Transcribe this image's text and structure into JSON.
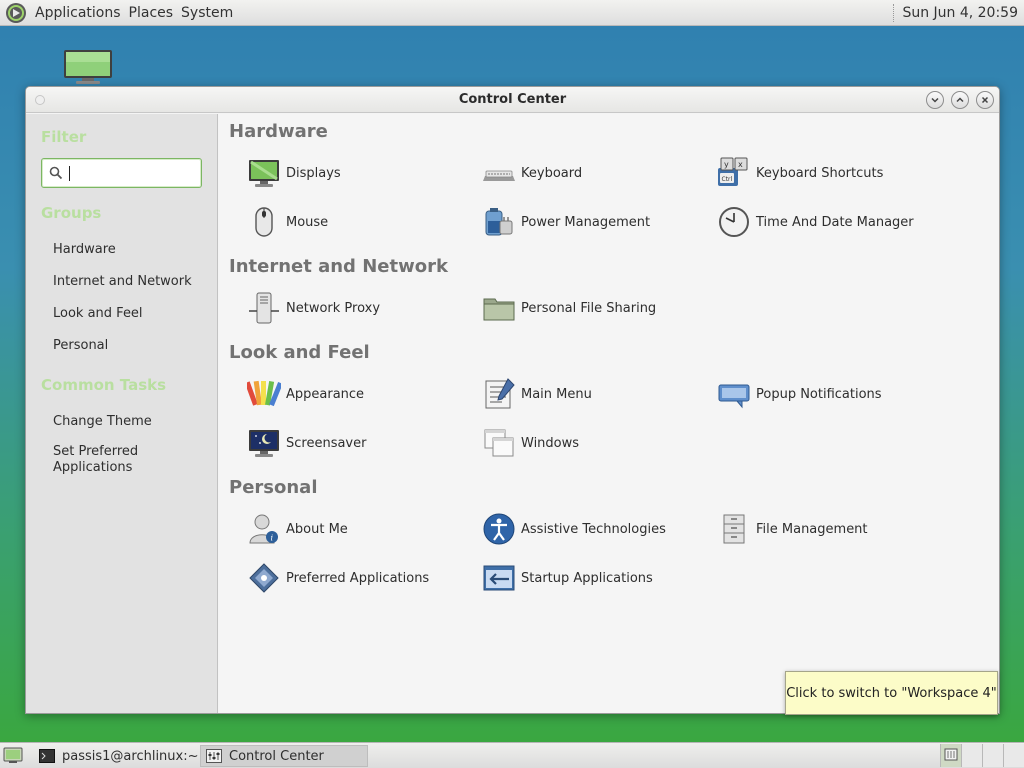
{
  "top_panel": {
    "menus": [
      "Applications",
      "Places",
      "System"
    ],
    "clock": "Sun Jun  4, 20:59"
  },
  "window": {
    "title": "Control Center"
  },
  "sidebar": {
    "filter_heading": "Filter",
    "filter_value": "",
    "groups_heading": "Groups",
    "groups": [
      "Hardware",
      "Internet and Network",
      "Look and Feel",
      "Personal"
    ],
    "tasks_heading": "Common Tasks",
    "tasks": [
      "Change Theme",
      "Set Preferred Applications"
    ]
  },
  "sections": [
    {
      "title": "Hardware",
      "items": [
        {
          "label": "Displays",
          "icon": "display-icon"
        },
        {
          "label": "Keyboard",
          "icon": "keyboard-icon"
        },
        {
          "label": "Keyboard Shortcuts",
          "icon": "keyboard-shortcuts-icon"
        },
        {
          "label": "Mouse",
          "icon": "mouse-icon"
        },
        {
          "label": "Power Management",
          "icon": "power-icon"
        },
        {
          "label": "Time And Date Manager",
          "icon": "clock-icon"
        }
      ]
    },
    {
      "title": "Internet and Network",
      "items": [
        {
          "label": "Network Proxy",
          "icon": "network-proxy-icon"
        },
        {
          "label": "Personal File Sharing",
          "icon": "folder-share-icon"
        }
      ]
    },
    {
      "title": "Look and Feel",
      "items": [
        {
          "label": "Appearance",
          "icon": "appearance-icon"
        },
        {
          "label": "Main Menu",
          "icon": "main-menu-icon"
        },
        {
          "label": "Popup Notifications",
          "icon": "notification-icon"
        },
        {
          "label": "Screensaver",
          "icon": "screensaver-icon"
        },
        {
          "label": "Windows",
          "icon": "windows-icon"
        }
      ]
    },
    {
      "title": "Personal",
      "items": [
        {
          "label": "About Me",
          "icon": "about-me-icon"
        },
        {
          "label": "Assistive Technologies",
          "icon": "accessibility-icon"
        },
        {
          "label": "File Management",
          "icon": "file-cabinet-icon"
        },
        {
          "label": "Preferred Applications",
          "icon": "preferred-apps-icon"
        },
        {
          "label": "Startup Applications",
          "icon": "startup-apps-icon"
        }
      ]
    }
  ],
  "notification": {
    "text": "Click to switch to \"Workspace 4\""
  },
  "bottom_panel": {
    "tasks": [
      "passis1@archlinux:~",
      "Control Center"
    ],
    "workspaces": 4
  },
  "colors": {
    "accent_green": "#7cb663",
    "sidebar_heading": "#b9dfa0",
    "section_title": "#727272",
    "notification_bg": "#fcfcc8"
  }
}
